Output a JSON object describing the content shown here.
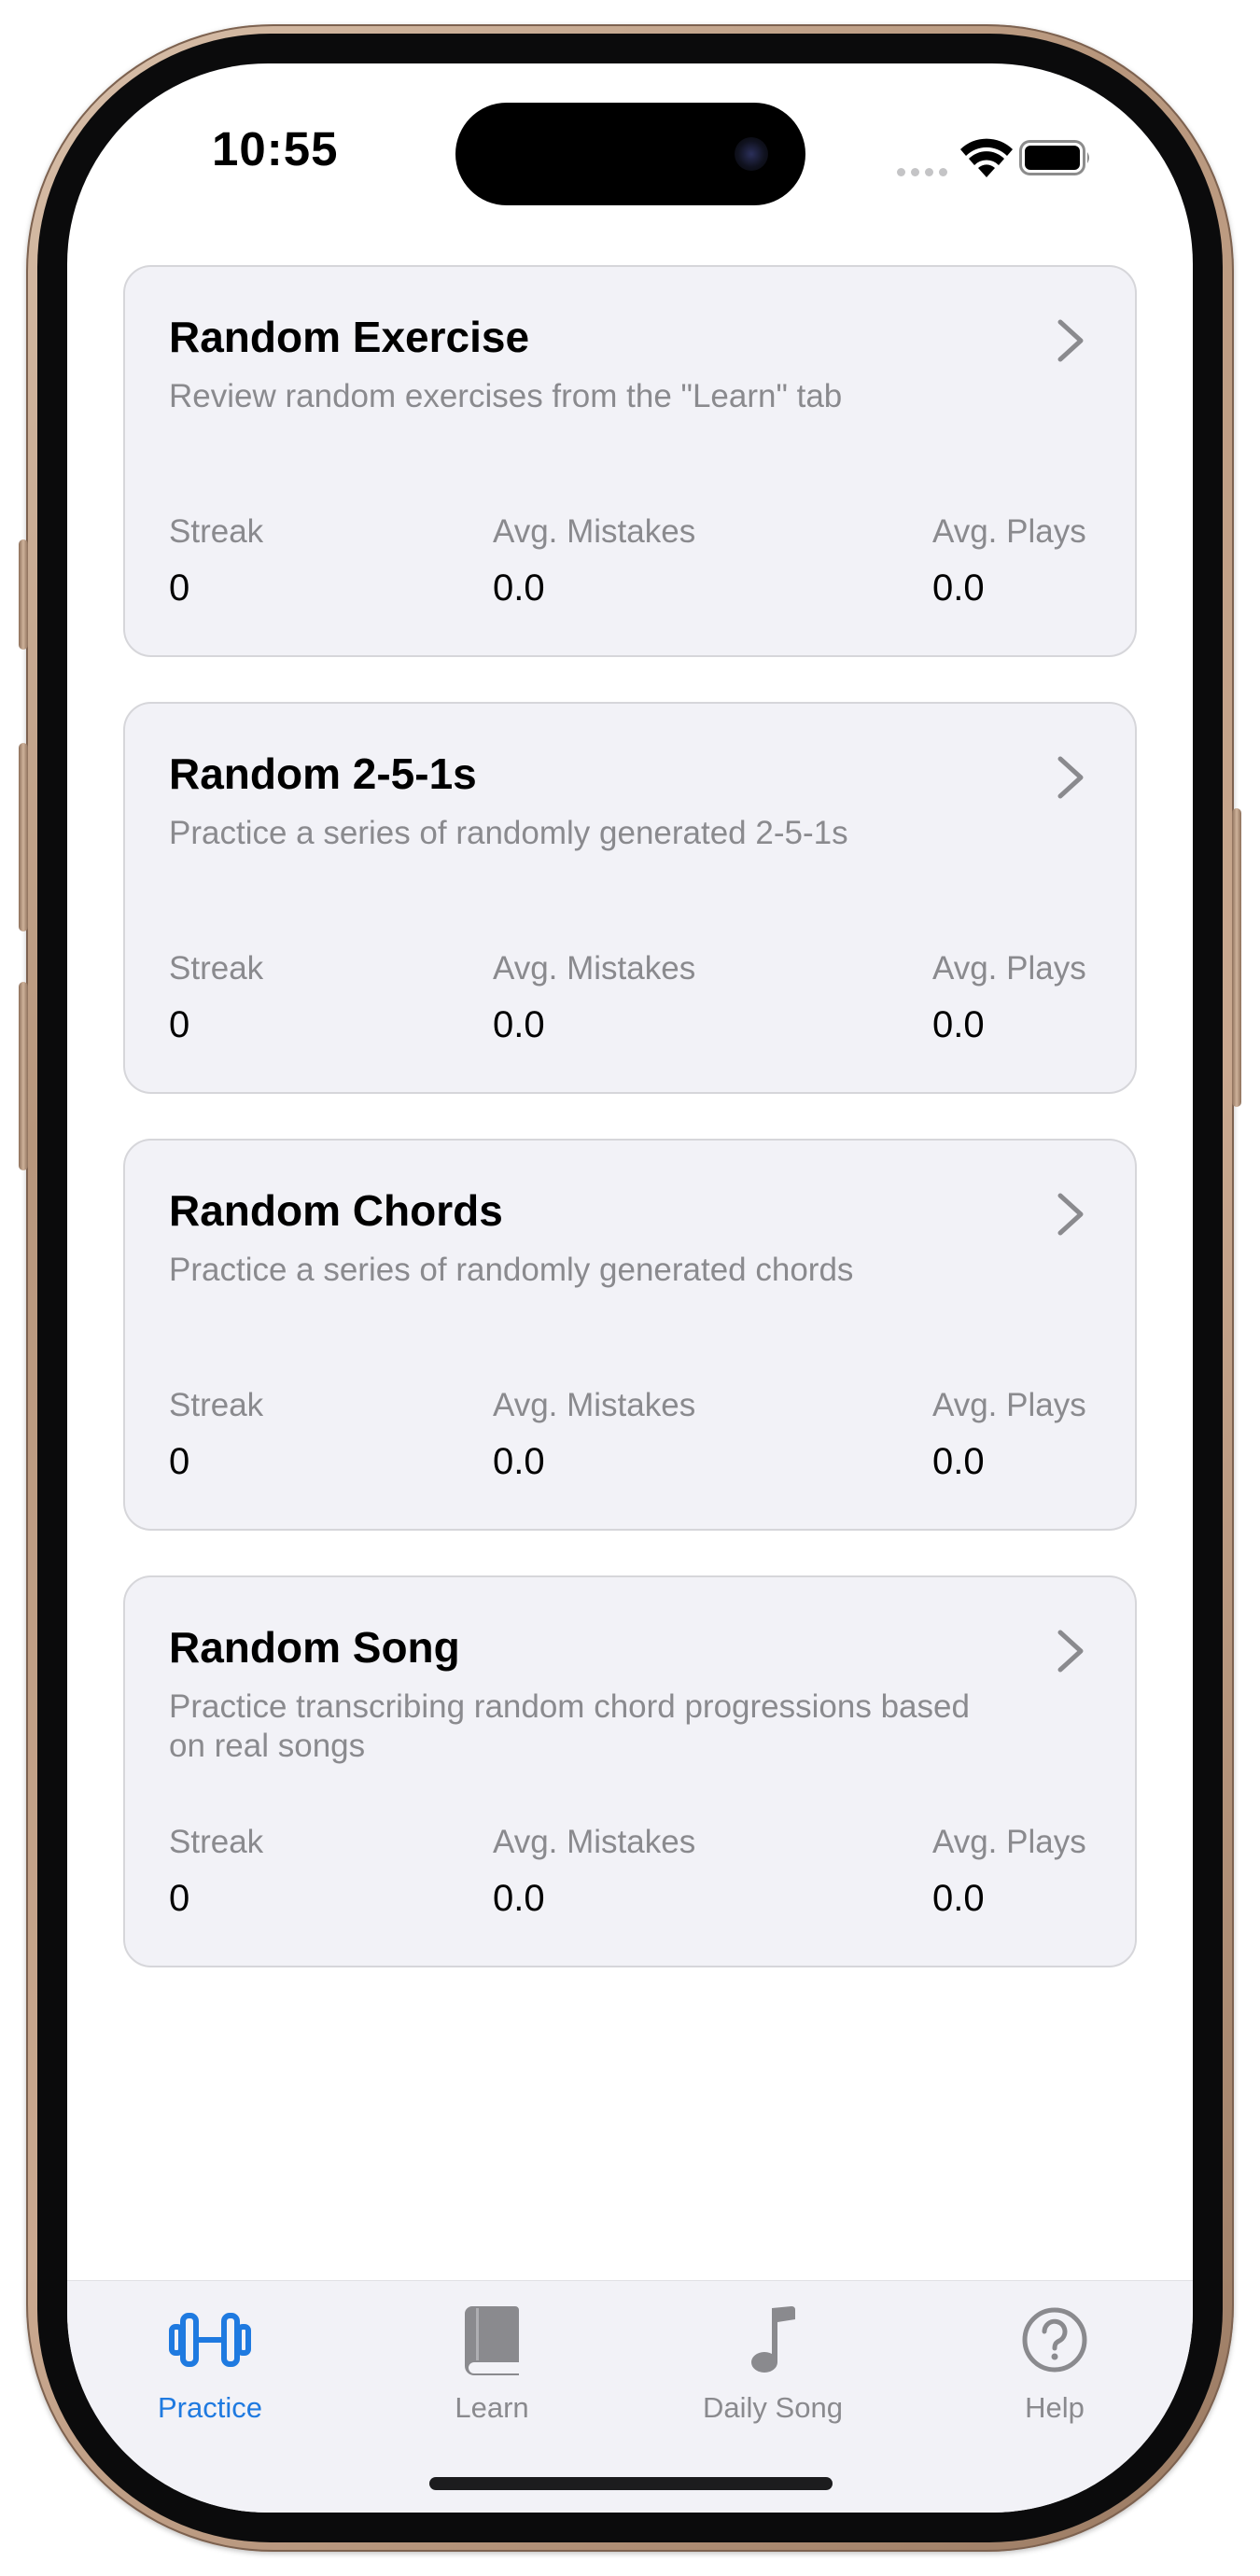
{
  "status_bar": {
    "time": "10:55"
  },
  "cards": [
    {
      "title": "Random Exercise",
      "description": "Review random exercises from the \"Learn\" tab",
      "stats": [
        {
          "label": "Streak",
          "value": "0"
        },
        {
          "label": "Avg. Mistakes",
          "value": "0.0"
        },
        {
          "label": "Avg. Plays",
          "value": "0.0"
        }
      ]
    },
    {
      "title": "Random 2-5-1s",
      "description": "Practice a series of randomly generated 2-5-1s",
      "stats": [
        {
          "label": "Streak",
          "value": "0"
        },
        {
          "label": "Avg. Mistakes",
          "value": "0.0"
        },
        {
          "label": "Avg. Plays",
          "value": "0.0"
        }
      ]
    },
    {
      "title": "Random Chords",
      "description": "Practice a series of randomly generated chords",
      "stats": [
        {
          "label": "Streak",
          "value": "0"
        },
        {
          "label": "Avg. Mistakes",
          "value": "0.0"
        },
        {
          "label": "Avg. Plays",
          "value": "0.0"
        }
      ]
    },
    {
      "title": "Random Song",
      "description": "Practice transcribing random chord progressions based on real songs",
      "stats": [
        {
          "label": "Streak",
          "value": "0"
        },
        {
          "label": "Avg. Mistakes",
          "value": "0.0"
        },
        {
          "label": "Avg. Plays",
          "value": "0.0"
        }
      ]
    }
  ],
  "tab_bar": {
    "tabs": [
      {
        "label": "Practice",
        "icon": "dumbbell-icon",
        "active": true
      },
      {
        "label": "Learn",
        "icon": "book-icon",
        "active": false
      },
      {
        "label": "Daily Song",
        "icon": "music-note-icon",
        "active": false
      },
      {
        "label": "Help",
        "icon": "question-circle-icon",
        "active": false
      }
    ]
  },
  "colors": {
    "accent": "#1f7ae0",
    "card_background": "#f2f2f7",
    "secondary_text": "#8a8a8e",
    "tab_inactive": "#8a8a8e"
  }
}
